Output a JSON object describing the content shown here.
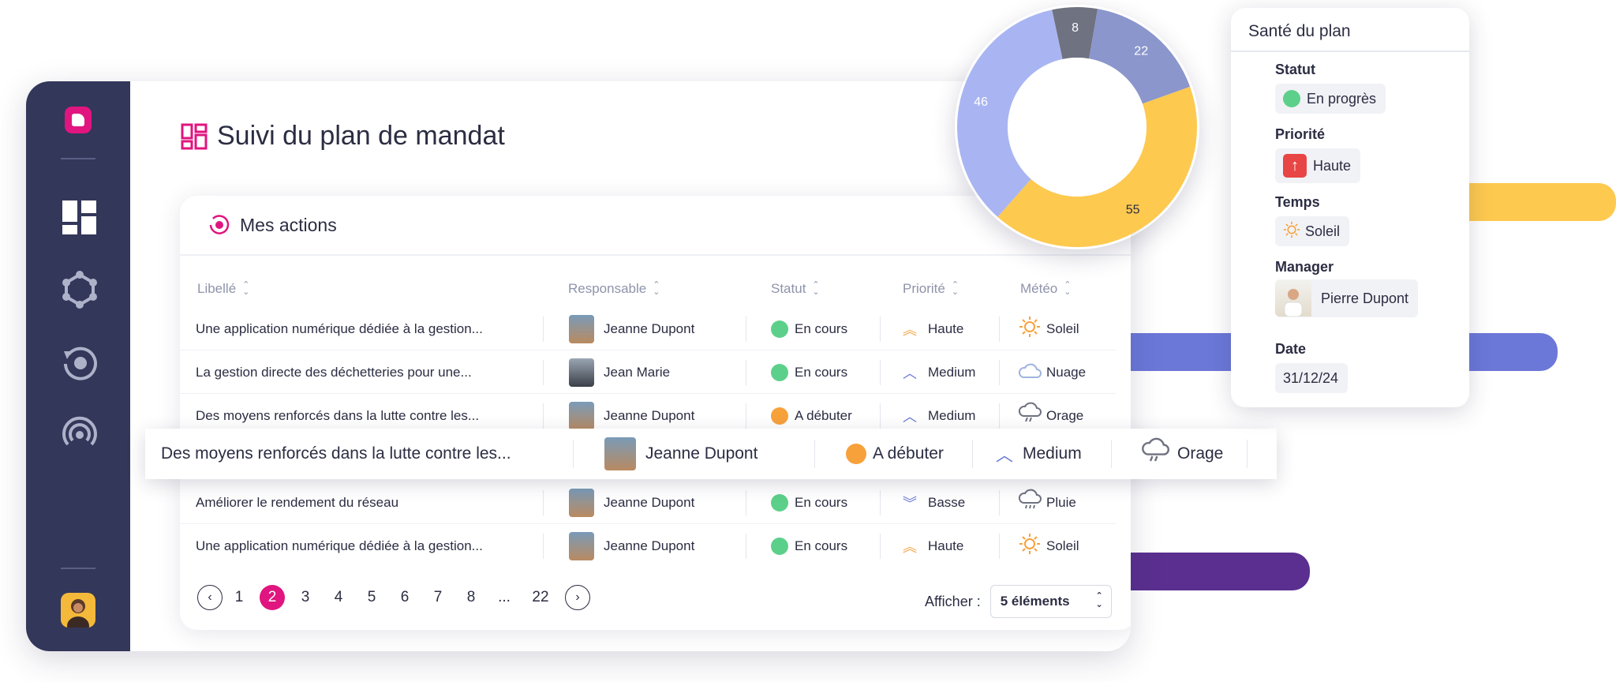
{
  "colors": {
    "accent": "#e0157f",
    "sidebar": "#33375a",
    "green": "#5cd08a",
    "orange": "#f7a13b",
    "yellow": "#fdc94f",
    "blue": "#6b78d8",
    "purple": "#5a2f8f"
  },
  "page": {
    "title": "Suivi du plan de mandat"
  },
  "card": {
    "title": "Mes actions",
    "columns": [
      "Libellé",
      "Responsable",
      "Statut",
      "Priorité",
      "Météo"
    ],
    "rows": [
      {
        "libelle": "Une application numérique dédiée à la gestion...",
        "responsable": "Jeanne Dupont",
        "statut": "En cours",
        "priorite": "Haute",
        "meteo": "Soleil"
      },
      {
        "libelle": "La gestion directe des déchetteries pour une...",
        "responsable": "Jean Marie",
        "statut": "En cours",
        "priorite": "Medium",
        "meteo": "Nuage"
      },
      {
        "libelle": "Des moyens renforcés dans la lutte contre les...",
        "responsable": "Jeanne Dupont",
        "statut": "A débuter",
        "priorite": "Medium",
        "meteo": "Orage"
      },
      {
        "libelle": "Améliorer le rendement du réseau",
        "responsable": "Jeanne Dupont",
        "statut": "En cours",
        "priorite": "Basse",
        "meteo": "Pluie"
      },
      {
        "libelle": "Une application numérique dédiée à la gestion...",
        "responsable": "Jeanne Dupont",
        "statut": "En cours",
        "priorite": "Haute",
        "meteo": "Soleil"
      }
    ],
    "highlight_row": {
      "libelle": "Des moyens renforcés dans la lutte contre les...",
      "responsable": "Jeanne Dupont",
      "statut": "A débuter",
      "priorite": "Medium",
      "meteo": "Orage"
    },
    "pagination": {
      "pages": [
        "1",
        "2",
        "3",
        "4",
        "5",
        "6",
        "7",
        "8",
        "...",
        "22"
      ],
      "current": "2"
    },
    "show": {
      "label": "Afficher :",
      "value": "5 éléments"
    }
  },
  "chart_data": {
    "type": "pie",
    "values": [
      8,
      22,
      55,
      46
    ],
    "colors": [
      "#6f7280",
      "#8b96cc",
      "#fdc94f",
      "#a9b5f2"
    ],
    "donut": true
  },
  "panel": {
    "title": "Santé du plan",
    "statut_label": "Statut",
    "statut": "En progrès",
    "priorite_label": "Priorité",
    "priorite": "Haute",
    "temps_label": "Temps",
    "temps": "Soleil",
    "manager_label": "Manager",
    "manager": "Pierre Dupont",
    "date_label": "Date",
    "date": "31/12/24"
  }
}
